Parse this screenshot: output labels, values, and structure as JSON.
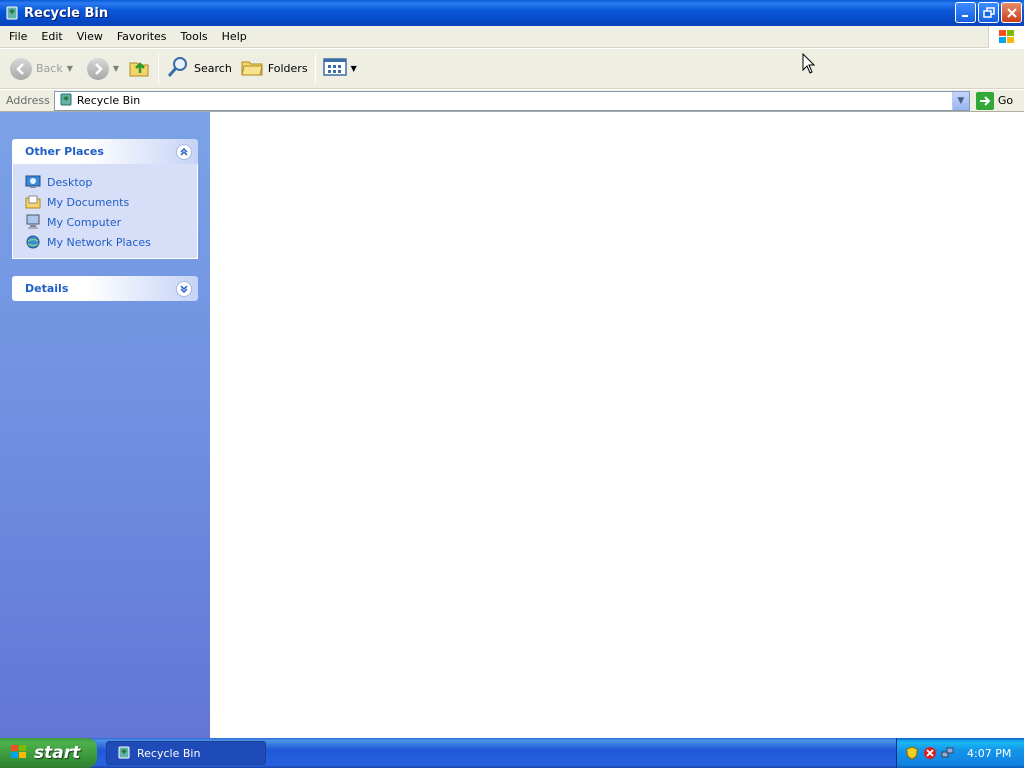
{
  "window": {
    "title": "Recycle Bin"
  },
  "menubar": {
    "items": [
      "File",
      "Edit",
      "View",
      "Favorites",
      "Tools",
      "Help"
    ]
  },
  "toolbar": {
    "back_label": "Back",
    "search_label": "Search",
    "folders_label": "Folders"
  },
  "addressbar": {
    "label": "Address",
    "value": "Recycle Bin",
    "go_label": "Go"
  },
  "sidepanel": {
    "other_places": {
      "title": "Other Places",
      "links": [
        "Desktop",
        "My Documents",
        "My Computer",
        "My Network Places"
      ]
    },
    "details": {
      "title": "Details"
    }
  },
  "taskbar": {
    "start_label": "start",
    "task_label": "Recycle Bin",
    "clock": "4:07 PM"
  },
  "colors": {
    "title_blue": "#0a58d8",
    "link_blue": "#215dc6",
    "start_green": "#3c9a3c"
  }
}
